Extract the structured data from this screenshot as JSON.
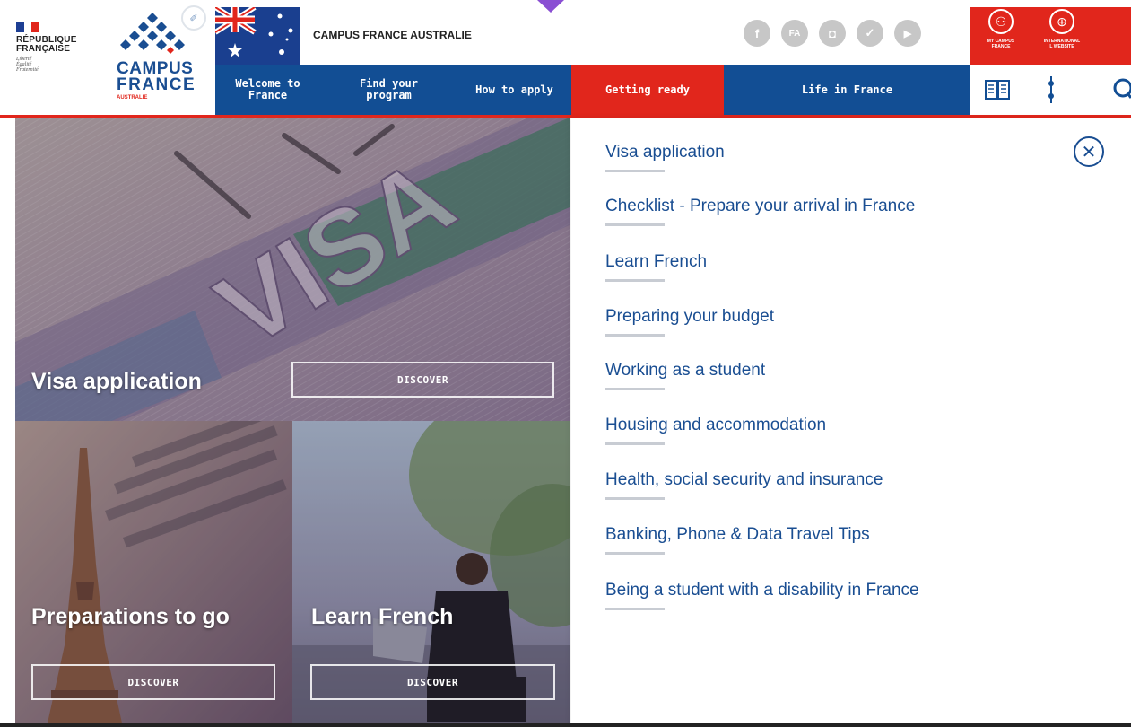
{
  "republique": {
    "name": "RÉPUBLIQUE\nFRANÇAISE",
    "motto": "Liberté\nÉgalité\nFraternité",
    "flag_colors": [
      "#1d3f94",
      "#ffffff",
      "#e1261c"
    ]
  },
  "campus_logo": {
    "line1": "CAMPUS",
    "line2": "FRANCE",
    "sub": "AUSTRALIE",
    "badge_icon": "compass-icon"
  },
  "header": {
    "site_title": "CAMPUS FRANCE AUSTRALIE"
  },
  "socials": [
    {
      "icon": "facebook-icon",
      "glyph": "f"
    },
    {
      "icon": "flickr-icon",
      "glyph": "FA"
    },
    {
      "icon": "instagram-icon",
      "glyph": "◘"
    },
    {
      "icon": "twitter-icon",
      "glyph": "✓"
    },
    {
      "icon": "youtube-icon",
      "glyph": "▶"
    }
  ],
  "top_links": [
    {
      "label": "MY CAMPUS\nFRANCE",
      "icon": "user-icon",
      "glyph": "⚇"
    },
    {
      "label": "INTERNATIONAL\nL WEBSITE",
      "icon": "globe-icon",
      "glyph": "⊕"
    }
  ],
  "nav": {
    "items": [
      {
        "label": "Welcome to\nFrance",
        "active": false
      },
      {
        "label": "Find your\nprogram",
        "active": false
      },
      {
        "label": "How to apply",
        "active": false
      },
      {
        "label": "Getting ready",
        "active": true
      },
      {
        "label": "Life in France",
        "active": false
      }
    ],
    "tools": [
      "book-icon",
      "more-icon",
      "search-icon"
    ]
  },
  "tiles": [
    {
      "title": "Visa application",
      "button": "DISCOVER",
      "image_text": "VISA"
    },
    {
      "title": "Preparations to go",
      "button": "DISCOVER"
    },
    {
      "title": "Learn French",
      "button": "DISCOVER"
    }
  ],
  "dropdown": {
    "items": [
      "Visa application",
      "Checklist - Prepare your arrival in France",
      "Learn French",
      "Preparing your budget",
      "Working as a student",
      "Housing and accommodation",
      "Health, social security and insurance",
      "Banking, Phone & Data Travel Tips",
      "Being a student with a disability in France"
    ],
    "close_icon": "close-icon"
  },
  "colors": {
    "brand_blue": "#124e94",
    "brand_red": "#e1261c",
    "link_blue": "#1a4e92"
  }
}
